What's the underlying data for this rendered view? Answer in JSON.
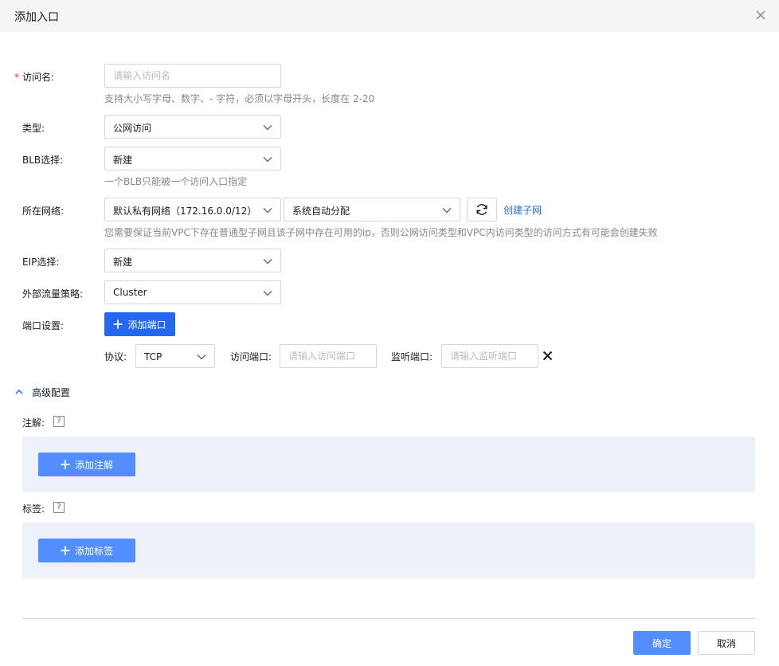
{
  "dialog": {
    "title": "添加入口"
  },
  "form": {
    "name": {
      "label": "访问名:",
      "required_mark": "*",
      "placeholder": "请输入访问名",
      "hint": "支持大小写字母、数字、- 字符，必须以字母开头，长度在 2-20"
    },
    "type": {
      "label": "类型:",
      "value": "公网访问"
    },
    "blb": {
      "label": "BLB选择:",
      "value": "新建",
      "hint": "一个BLB只能被一个访问入口指定"
    },
    "network": {
      "label": "所在网络:",
      "vpc_value": "默认私有网络（172.16.0.0/12）",
      "subnet_value": "系统自动分配",
      "create_subnet_link": "创建子网",
      "hint": "您需要保证当前VPC下存在普通型子网且该子网中存在可用的ip，否则公网访问类型和VPC内访问类型的访问方式有可能会创建失败"
    },
    "eip": {
      "label": "EIP选择:",
      "value": "新建"
    },
    "traffic_policy": {
      "label": "外部流量策略:",
      "value": "Cluster"
    },
    "ports": {
      "label": "端口设置:",
      "add_button": "添加端口",
      "protocol_label": "协议:",
      "protocol_value": "TCP",
      "access_port_label": "访问端口:",
      "access_port_placeholder": "请输入访问端口",
      "listen_port_label": "监听端口:",
      "listen_port_placeholder": "请输入监听端口"
    }
  },
  "advanced": {
    "toggle_label": "高级配置",
    "annotations": {
      "label": "注解:",
      "help": "?",
      "add_button": "添加注解"
    },
    "tags": {
      "label": "标签:",
      "help": "?",
      "add_button": "添加标签"
    }
  },
  "footer": {
    "confirm": "确定",
    "cancel": "取消"
  },
  "colors": {
    "primary": "#2468f2",
    "primary_light": "#528eff",
    "panel_bg": "#eef1f9",
    "required": "#ea2e2e"
  }
}
